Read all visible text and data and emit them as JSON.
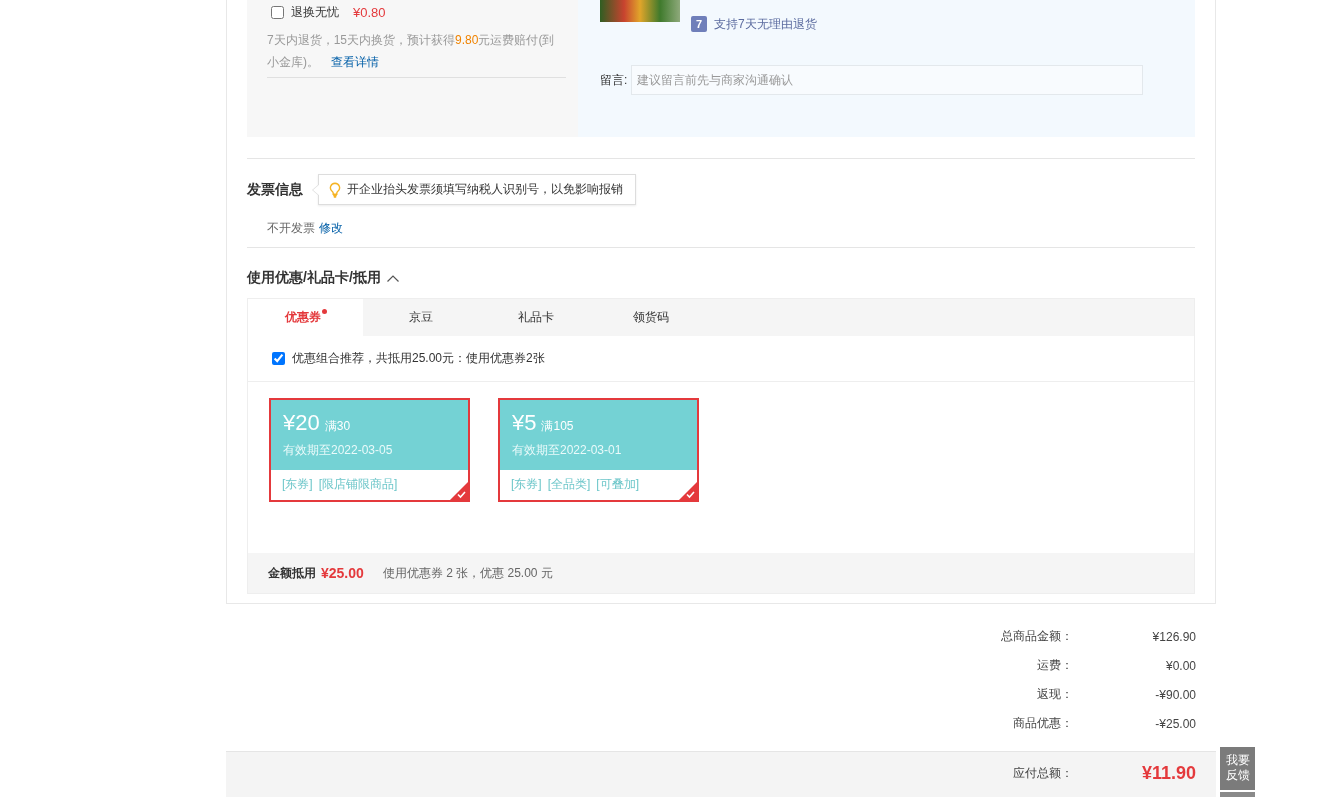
{
  "return_service": {
    "checked": false,
    "label": "退换无忧",
    "price": "¥0.80",
    "description": {
      "before": "7天内退货，15天内换货，预计获得",
      "highlight": "9.80",
      "after": "元运费赔付(到小金库)。"
    },
    "link": "查看详情"
  },
  "product": {
    "service_badge": "7",
    "service": "支持7天无理由退货"
  },
  "note": {
    "label": "留言:",
    "placeholder": "建议留言前先与商家沟通确认"
  },
  "invoice": {
    "title": "发票信息",
    "tip": "开企业抬头发票须填写纳税人识别号，以免影响报销",
    "status": "不开发票",
    "edit_link": "修改"
  },
  "discounts": {
    "title": "使用优惠/礼品卡/抵用",
    "expanded": true,
    "tabs": [
      {
        "label": "优惠券",
        "selected": true,
        "dot": true
      },
      {
        "label": "京豆",
        "selected": false,
        "dot": false
      },
      {
        "label": "礼品卡",
        "selected": false,
        "dot": false
      },
      {
        "label": "领货码",
        "selected": false,
        "dot": false
      }
    ],
    "recommend": {
      "checked": true,
      "text": "优惠组合推荐，共抵用25.00元：使用优惠券2张"
    },
    "coupons": [
      {
        "amount": "¥20",
        "condition": "满30",
        "validity": "有效期至2022-03-05",
        "tags": [
          "[东券]",
          "[限店铺限商品]"
        ],
        "selected": true
      },
      {
        "amount": "¥5",
        "condition": "满105",
        "validity": "有效期至2022-03-01",
        "tags": [
          "[东券]",
          "[全品类]",
          "[可叠加]"
        ],
        "selected": true
      }
    ],
    "footer": {
      "label": "金额抵用",
      "amount": "¥25.00",
      "summary": "使用优惠券 2 张，优惠 25.00 元"
    }
  },
  "summary": {
    "rows": [
      {
        "label": "总商品金额：",
        "value": "¥126.90"
      },
      {
        "label": "运费：",
        "value": "¥0.00"
      },
      {
        "label": "返现：",
        "value": "-¥90.00"
      },
      {
        "label": "商品优惠：",
        "value": "-¥25.00"
      }
    ],
    "total": {
      "label": "应付总额：",
      "value": "¥11.90"
    }
  },
  "side_tools": {
    "feedback": "我要反馈"
  }
}
